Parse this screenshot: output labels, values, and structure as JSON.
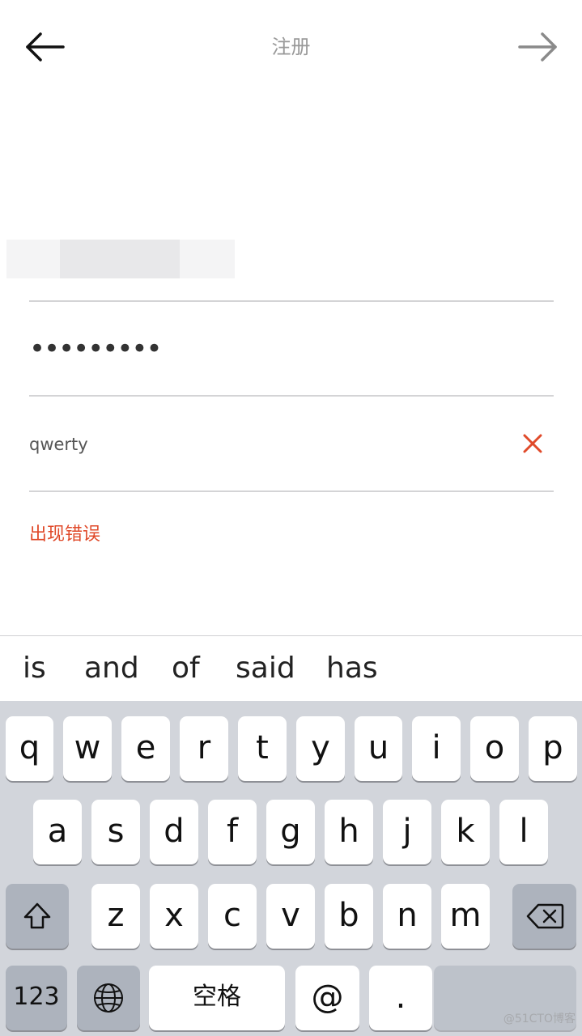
{
  "header": {
    "title": "注册",
    "back_icon": "arrow-left-icon",
    "forward_icon": "arrow-right-icon"
  },
  "form": {
    "password_masked": "•••••••••",
    "confirm_value": "qwerty",
    "error_message": "出现错误",
    "clear_icon": "close-icon"
  },
  "suggestions": [
    "is",
    "and",
    "of",
    "said",
    "has"
  ],
  "keyboard": {
    "row1": [
      "q",
      "w",
      "e",
      "r",
      "t",
      "y",
      "u",
      "i",
      "o",
      "p"
    ],
    "row2": [
      "a",
      "s",
      "d",
      "f",
      "g",
      "h",
      "j",
      "k",
      "l"
    ],
    "row3": [
      "z",
      "x",
      "c",
      "v",
      "b",
      "n",
      "m"
    ],
    "numbers_label": "123",
    "space_label": "空格",
    "at_label": "@",
    "dot_label": "."
  },
  "watermark": "@51CTO博客",
  "colors": {
    "error": "#e04a2a",
    "title_gray": "#999999",
    "keyboard_bg": "#d2d5db"
  }
}
